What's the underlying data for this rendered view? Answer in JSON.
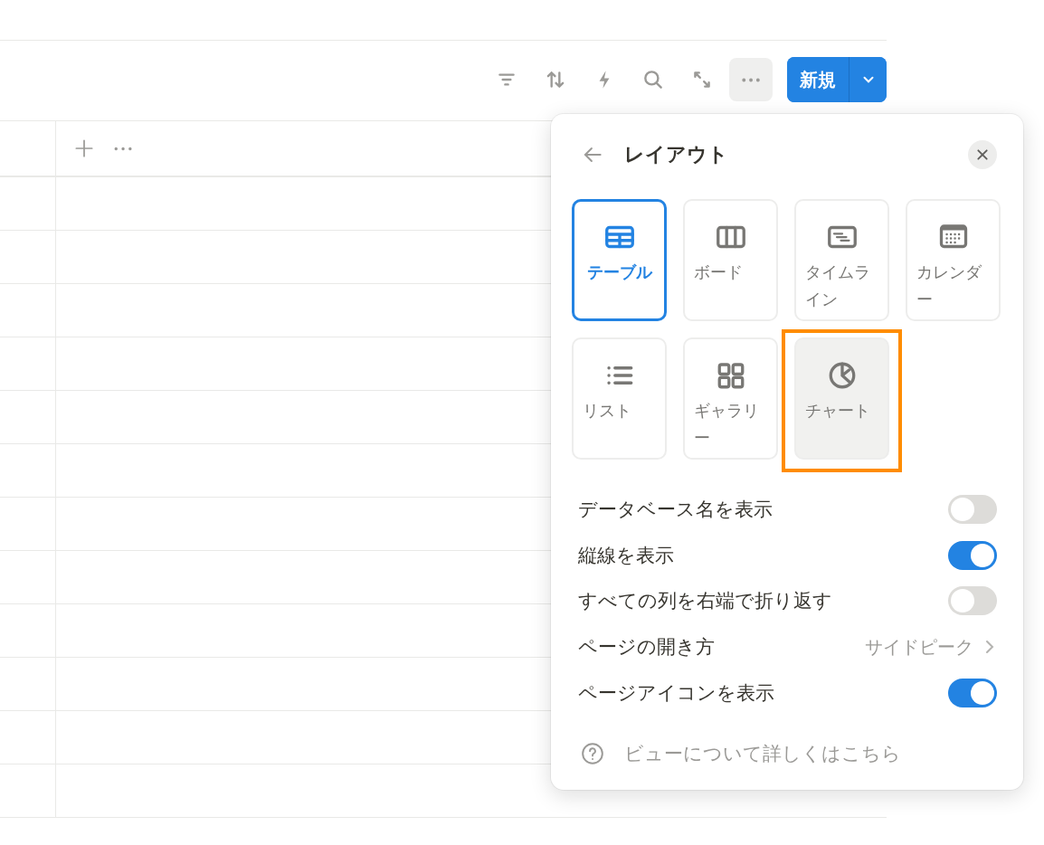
{
  "toolbar": {
    "new_button": {
      "label": "新規"
    }
  },
  "layout_menu": {
    "title": "レイアウト",
    "layouts": [
      {
        "kind": "table",
        "label": "テーブル",
        "selected": true,
        "highlighted": false
      },
      {
        "kind": "board",
        "label": "ボード",
        "selected": false,
        "highlighted": false
      },
      {
        "kind": "timeline",
        "label": "タイムライン",
        "selected": false,
        "highlighted": false
      },
      {
        "kind": "calendar",
        "label": "カレンダー",
        "selected": false,
        "highlighted": false
      },
      {
        "kind": "list",
        "label": "リスト",
        "selected": false,
        "highlighted": false
      },
      {
        "kind": "gallery",
        "label": "ギャラリー",
        "selected": false,
        "highlighted": false
      },
      {
        "kind": "chart",
        "label": "チャート",
        "selected": false,
        "highlighted": true
      }
    ],
    "settings": [
      {
        "kind": "toggle",
        "label": "データベース名を表示",
        "on": false
      },
      {
        "kind": "toggle",
        "label": "縦線を表示",
        "on": true
      },
      {
        "kind": "toggle",
        "label": "すべての列を右端で折り返す",
        "on": false
      },
      {
        "kind": "option",
        "label": "ページの開き方",
        "value": "サイドピーク"
      },
      {
        "kind": "toggle",
        "label": "ページアイコンを表示",
        "on": true
      }
    ],
    "help_link": "ビューについて詳しくはこちら"
  }
}
